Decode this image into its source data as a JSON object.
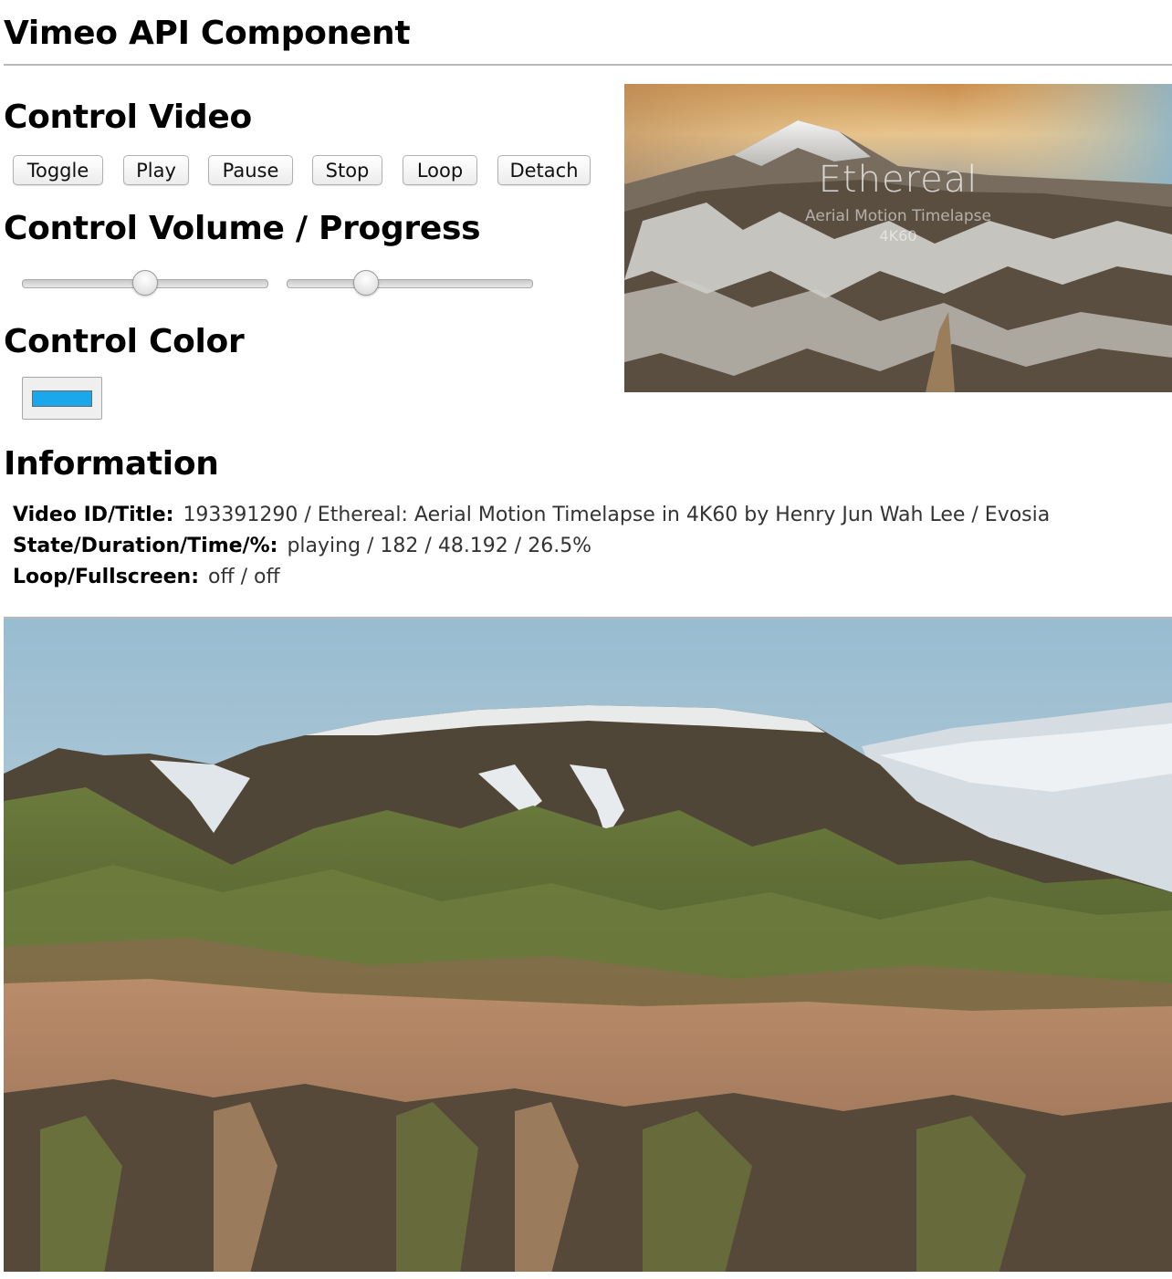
{
  "page": {
    "title": "Vimeo API Component"
  },
  "sections": {
    "control_video": "Control Video",
    "control_volume_progress": "Control Volume / Progress",
    "control_color": "Control Color",
    "information": "Information"
  },
  "buttons": {
    "toggle": "Toggle",
    "play": "Play",
    "pause": "Pause",
    "stop": "Stop",
    "loop": "Loop",
    "detach": "Detach"
  },
  "sliders": {
    "volume_fraction": 0.5,
    "progress_fraction": 0.3
  },
  "color_control": {
    "value": "#1aa7ec"
  },
  "info": {
    "rows": [
      {
        "label": "Video ID/Title:",
        "value": "193391290 / Ethereal: Aerial Motion Timelapse in 4K60 by Henry Jun Wah Lee / Evosia"
      },
      {
        "label": "State/Duration/Time/%:",
        "value": "playing / 182 / 48.192 / 26.5%"
      },
      {
        "label": "Loop/Fullscreen:",
        "value": "off / off"
      }
    ]
  },
  "thumbnail": {
    "title": "Ethereal",
    "subtitle": "Aerial Motion Timelapse",
    "resolution": "4K60"
  }
}
